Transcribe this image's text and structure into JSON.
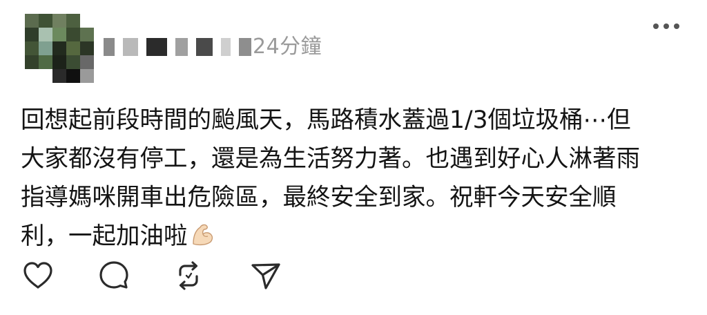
{
  "post": {
    "timestamp": "24分鐘",
    "body_lines": [
      "回想起前段時間的颱風天，馬路積水蓋過1/3個垃圾桶⋯但",
      "大家都沒有停工，還是為生活努力著。也遇到好心人淋著雨",
      "指導媽咪開車出危險區，最終安全到家。祝軒今天安全順",
      "利，一起加油啦"
    ],
    "emoji": "flexed-biceps"
  },
  "icons": {
    "more": "more-horizontal-icon",
    "like": "heart-icon",
    "comment": "comment-icon",
    "repost": "repost-icon",
    "share": "share-icon"
  },
  "colors": {
    "text": "#141414",
    "muted": "#9a9a9a",
    "icon": "#2b2b2b",
    "background": "#ffffff"
  }
}
